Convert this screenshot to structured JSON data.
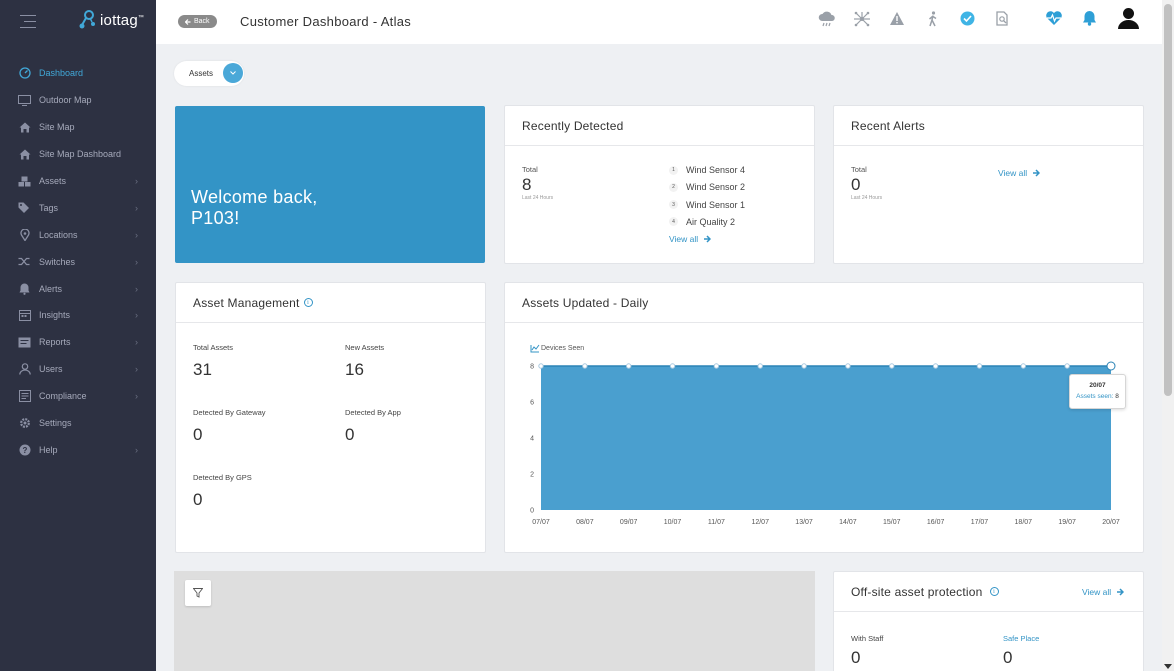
{
  "app": {
    "logo_text": "iottag",
    "logo_tm": "™"
  },
  "sidebar": {
    "items": [
      {
        "label": "Dashboard",
        "icon": "dashboard-icon",
        "active": true,
        "chevron": false
      },
      {
        "label": "Outdoor Map",
        "icon": "monitor-icon",
        "active": false,
        "chevron": false
      },
      {
        "label": "Site Map",
        "icon": "home-icon",
        "active": false,
        "chevron": false
      },
      {
        "label": "Site Map Dashboard",
        "icon": "home-icon",
        "active": false,
        "chevron": false
      },
      {
        "label": "Assets",
        "icon": "cubes-icon",
        "active": false,
        "chevron": true
      },
      {
        "label": "Tags",
        "icon": "tags-icon",
        "active": false,
        "chevron": true
      },
      {
        "label": "Locations",
        "icon": "map-pin-icon",
        "active": false,
        "chevron": true
      },
      {
        "label": "Switches",
        "icon": "shuffle-icon",
        "active": false,
        "chevron": true
      },
      {
        "label": "Alerts",
        "icon": "bell-icon",
        "active": false,
        "chevron": true
      },
      {
        "label": "Insights",
        "icon": "calendar-icon",
        "active": false,
        "chevron": true
      },
      {
        "label": "Reports",
        "icon": "report-icon",
        "active": false,
        "chevron": true
      },
      {
        "label": "Users",
        "icon": "users-icon",
        "active": false,
        "chevron": true
      },
      {
        "label": "Compliance",
        "icon": "document-icon",
        "active": false,
        "chevron": true
      },
      {
        "label": "Settings",
        "icon": "gear-icon",
        "active": false,
        "chevron": false
      },
      {
        "label": "Help",
        "icon": "help-icon",
        "active": false,
        "chevron": true
      }
    ]
  },
  "header": {
    "back_label": "Back",
    "title": "Customer Dashboard - Atlas",
    "icons": [
      "cloud-icon",
      "network-icon",
      "warning-icon",
      "walking-person-icon",
      "check-circle-icon",
      "search-document-icon",
      "heart-pulse-icon",
      "bell-icon",
      "user-avatar-icon"
    ]
  },
  "assets_dropdown": {
    "label": "Assets"
  },
  "welcome": {
    "line1": "Welcome back,",
    "line2": "P103!"
  },
  "recently_detected": {
    "title": "Recently Detected",
    "total_label": "Total",
    "total_value": "8",
    "period": "Last 24 Hours",
    "items": [
      {
        "rank": "1",
        "name": "Wind Sensor 4"
      },
      {
        "rank": "2",
        "name": "Wind Sensor 2"
      },
      {
        "rank": "3",
        "name": "Wind Sensor 1"
      },
      {
        "rank": "4",
        "name": "Air Quality 2"
      }
    ],
    "view_all": "View all"
  },
  "recent_alerts": {
    "title": "Recent Alerts",
    "total_label": "Total",
    "total_value": "0",
    "period": "Last 24 Hours",
    "view_all": "View all"
  },
  "asset_management": {
    "title": "Asset Management",
    "stats": [
      {
        "label": "Total Assets",
        "value": "31"
      },
      {
        "label": "New Assets",
        "value": "16"
      },
      {
        "label": "Detected By Gateway",
        "value": "0"
      },
      {
        "label": "Detected By App",
        "value": "0"
      },
      {
        "label": "Detected By GPS",
        "value": "0"
      }
    ]
  },
  "assets_updated": {
    "title": "Assets Updated - Daily",
    "tooltip": {
      "date": "20/07",
      "label": "Assets seen:",
      "value": "8"
    }
  },
  "offsite": {
    "title": "Off-site asset protection",
    "view_all": "View all",
    "with_staff_label": "With Staff",
    "with_staff_value": "0",
    "safe_place_label": "Safe Place",
    "safe_place_value": "0"
  },
  "colors": {
    "sidebar": "#2d3142",
    "accent": "#3394c6",
    "chart_fill": "#4a9fcf"
  },
  "chart_data": {
    "type": "area",
    "legend": "Devices Seen",
    "x": [
      "07/07",
      "08/07",
      "09/07",
      "10/07",
      "11/07",
      "12/07",
      "13/07",
      "14/07",
      "15/07",
      "16/07",
      "17/07",
      "18/07",
      "19/07",
      "20/07"
    ],
    "series": [
      {
        "name": "Devices Seen",
        "values": [
          8,
          8,
          8,
          8,
          8,
          8,
          8,
          8,
          8,
          8,
          8,
          8,
          8,
          8
        ]
      }
    ],
    "yticks": [
      "0",
      "2",
      "4",
      "6",
      "8"
    ],
    "ylim": [
      0,
      8
    ],
    "legend_position": "top-left",
    "grid": false
  }
}
